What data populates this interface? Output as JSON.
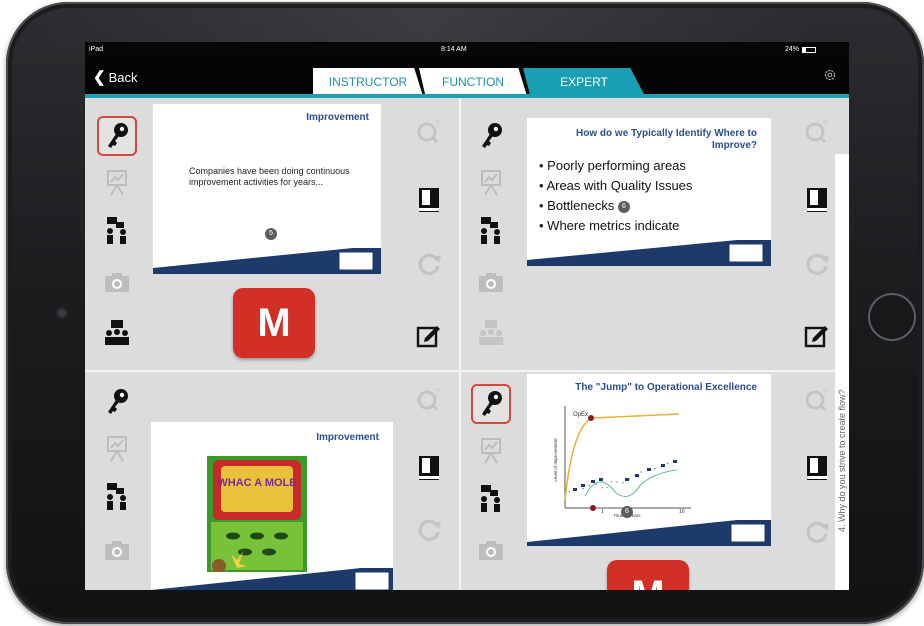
{
  "status": {
    "device": "iPad",
    "time": "8:14 AM",
    "battery": "24%"
  },
  "nav": {
    "back_label": "Back"
  },
  "tabs": [
    {
      "label": "INSTRUCTOR",
      "active": false
    },
    {
      "label": "FUNCTION",
      "active": false
    },
    {
      "label": "EXPERT",
      "active": true
    }
  ],
  "colors": {
    "accent": "#1aa0b2",
    "selection": "#d6473c",
    "badge": "#d22f27",
    "slide_title": "#2a4f8c"
  },
  "panels": [
    {
      "slide_title": "Improvement",
      "slide_body": "Companies have been doing continuous improvement activities for years...",
      "slide_number": "5",
      "badge": "M"
    },
    {
      "slide_title": "How do we Typically Identify Where to Improve?",
      "bullets": [
        "Poorly performing areas",
        "Areas with Quality Issues",
        "Bottlenecks",
        "Where metrics indicate"
      ],
      "slide_number": "6"
    },
    {
      "slide_title": "Improvement",
      "image_caption": "WHAC A MOLE"
    },
    {
      "slide_title": "The \"Jump\" to Operational Excellence",
      "chart": {
        "curve_label": "OpEx",
        "ylabel": "Level of Improvement",
        "xlabel": "Time in Years",
        "x_ticks": [
          "1",
          "10"
        ]
      },
      "slide_number": "6",
      "badge": "M"
    }
  ],
  "right_edge_text": "4.   Why do you strive to create flow?"
}
